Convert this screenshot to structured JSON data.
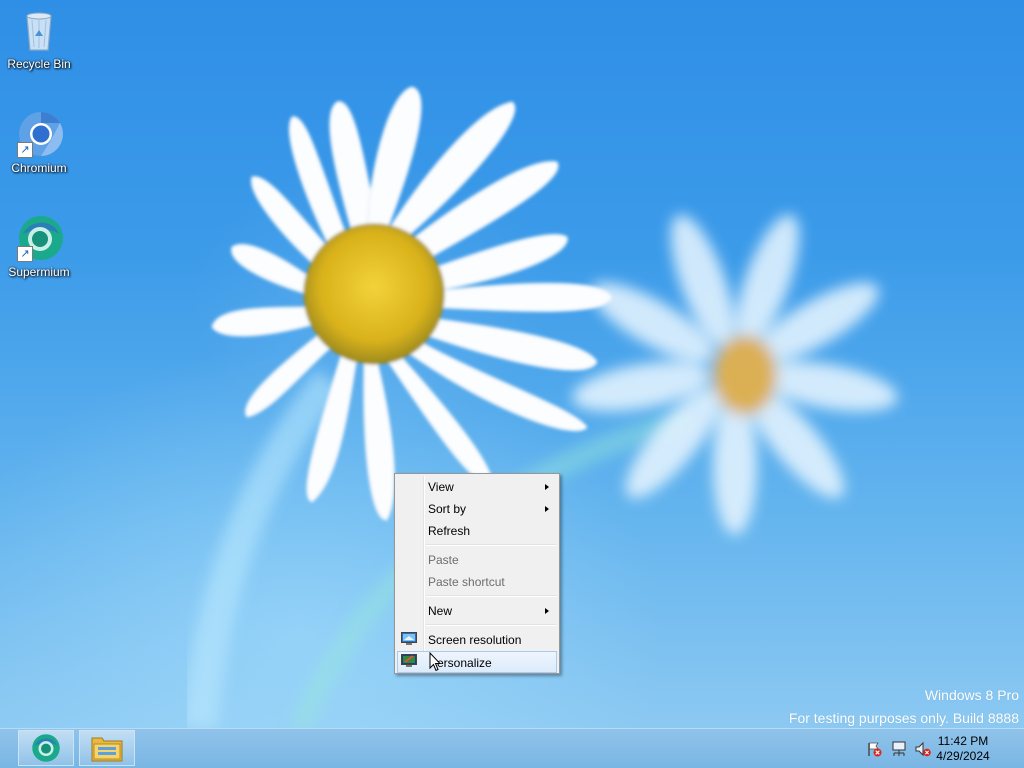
{
  "desktop": {
    "icons": [
      {
        "label": "Recycle Bin",
        "icon": "recycle-bin-icon"
      },
      {
        "label": "Chromium",
        "icon": "chromium-icon"
      },
      {
        "label": "Supermium",
        "icon": "supermium-icon"
      }
    ]
  },
  "context_menu": {
    "items": [
      {
        "label": "View",
        "submenu": true,
        "enabled": true
      },
      {
        "label": "Sort by",
        "submenu": true,
        "enabled": true
      },
      {
        "label": "Refresh",
        "submenu": false,
        "enabled": true
      },
      {
        "label": "Paste",
        "submenu": false,
        "enabled": false
      },
      {
        "label": "Paste shortcut",
        "submenu": false,
        "enabled": false
      },
      {
        "label": "New",
        "submenu": true,
        "enabled": true
      },
      {
        "label": "Screen resolution",
        "icon": "screen-resolution-icon",
        "enabled": true
      },
      {
        "label": "Personalize",
        "icon": "personalize-icon",
        "enabled": true,
        "highlighted": true
      }
    ]
  },
  "watermark": {
    "line1": "Windows 8 Pro",
    "line2": "For testing purposes only. Build 8888"
  },
  "taskbar": {
    "pinned": [
      {
        "icon": "supermium-icon"
      },
      {
        "icon": "file-explorer-icon"
      }
    ],
    "tray": {
      "icons": [
        "action-center-flag-icon",
        "network-icon",
        "volume-muted-icon"
      ],
      "time": "11:42 PM",
      "date": "4/29/2024"
    }
  },
  "colors": {
    "desktop_blue": "#3c9be9",
    "taskbar": "#85bde7",
    "menu_highlight": "#dcebfc"
  }
}
